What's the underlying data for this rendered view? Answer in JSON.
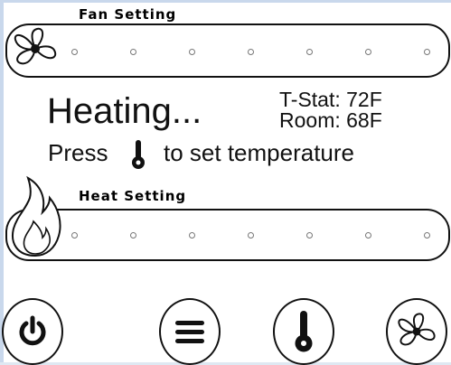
{
  "fan_setting": {
    "title": "Fan Setting",
    "icon": "fan-icon",
    "level_count": 7
  },
  "status": {
    "mode": "Heating...",
    "tstat": "T-Stat: 72F",
    "room": "Room: 68F",
    "hint_prefix": "Press",
    "hint_icon": "thermometer-icon",
    "hint_suffix": "to set temperature"
  },
  "heat_setting": {
    "title": "Heat Setting",
    "icon": "flame-icon",
    "level_count": 7
  },
  "buttons": [
    "power-icon",
    "menu-icon",
    "thermometer-icon",
    "fan-icon"
  ],
  "colors": {
    "background": "#ffffff",
    "frame": "#c9d8ec",
    "ink": "#111111"
  }
}
